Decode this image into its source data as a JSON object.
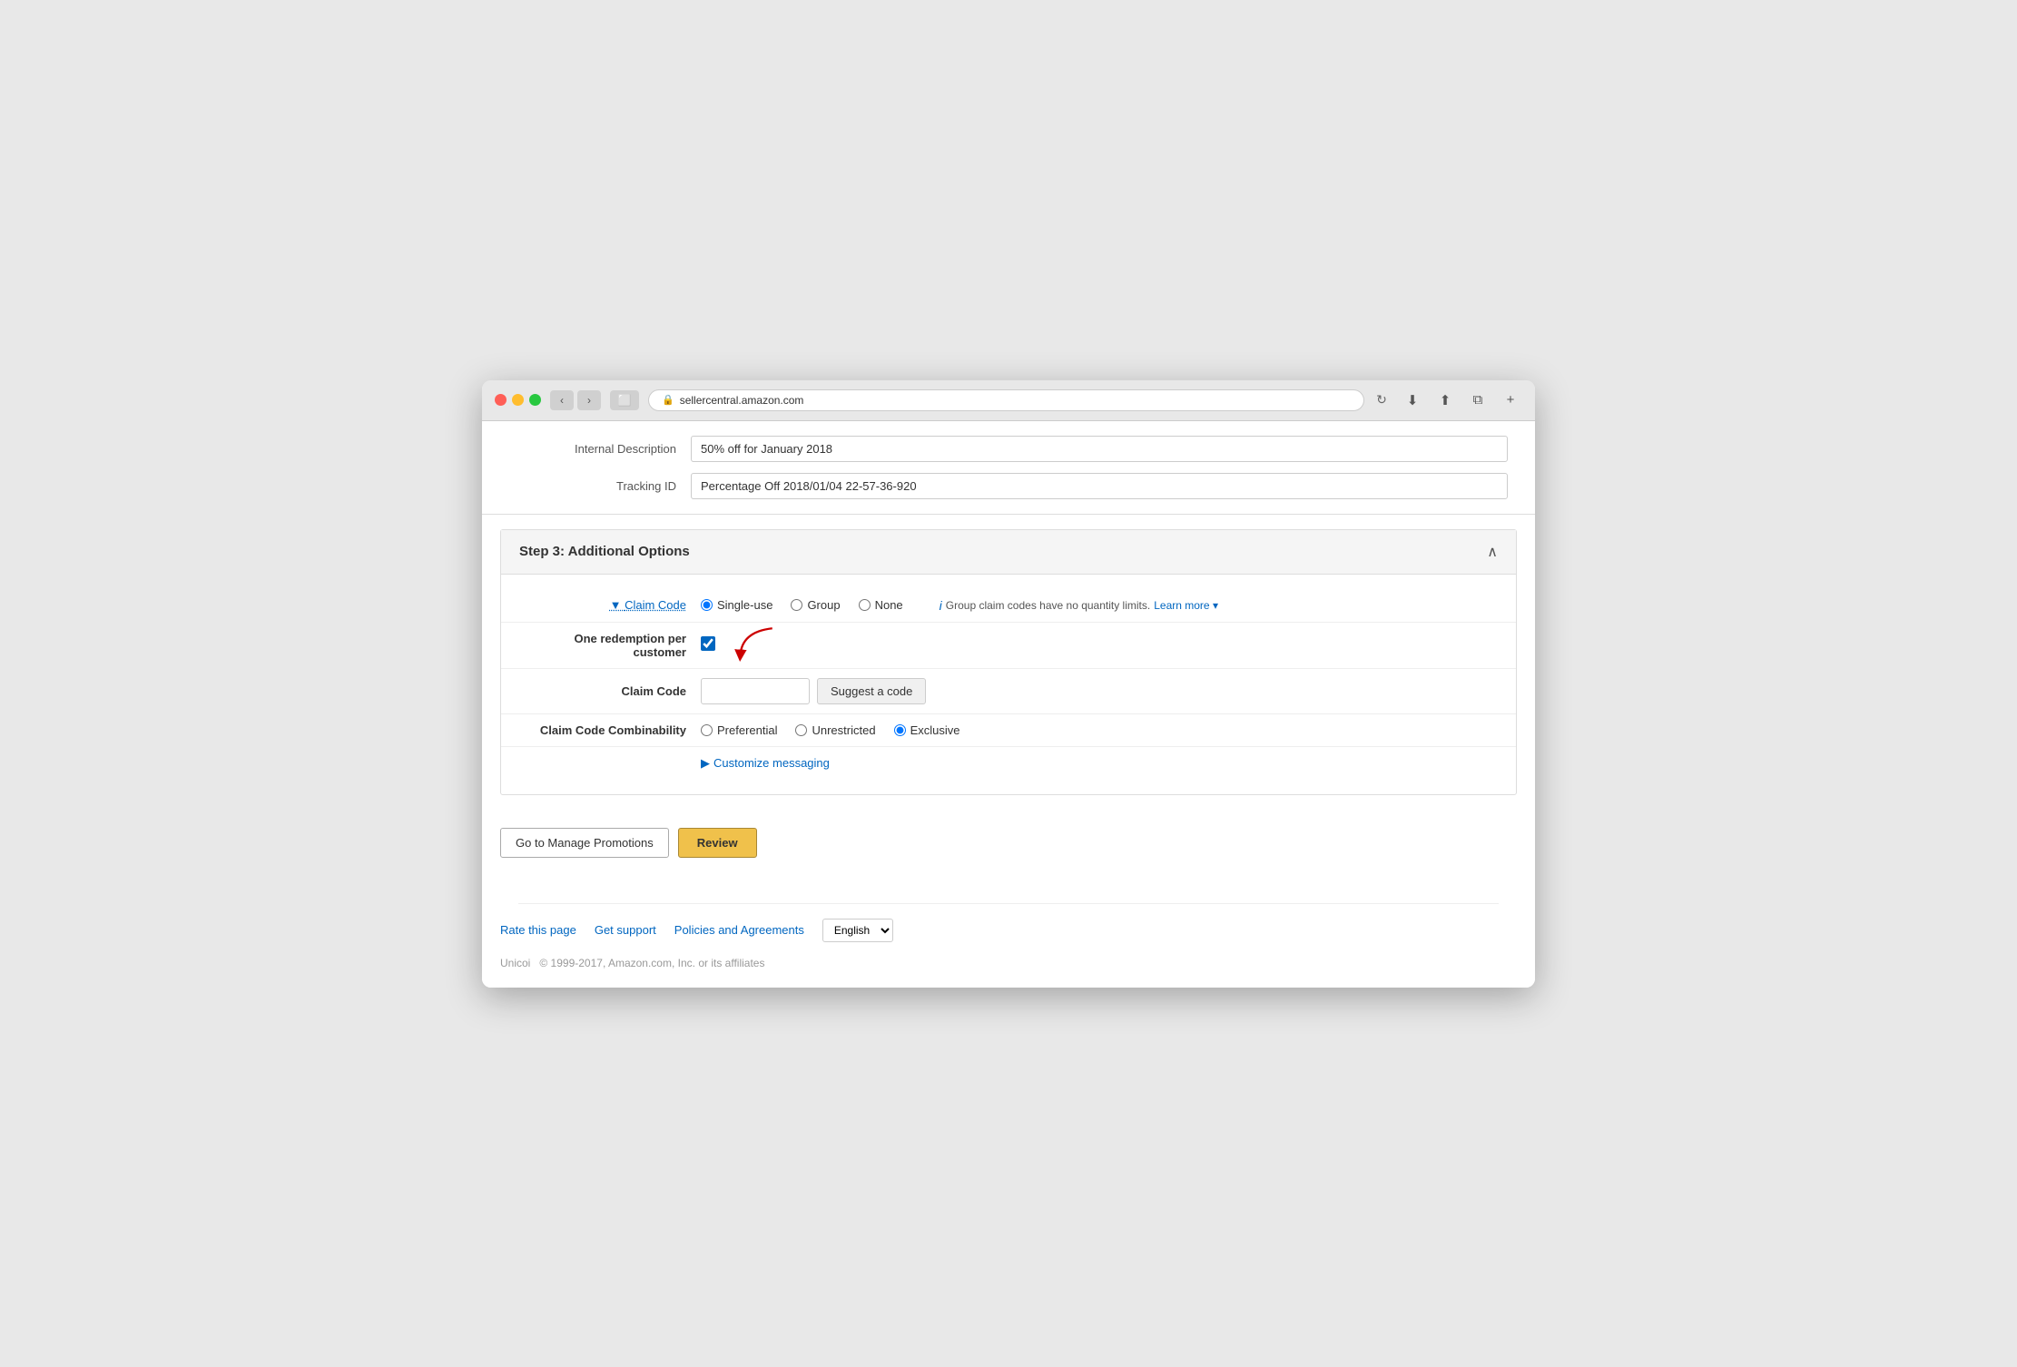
{
  "browser": {
    "url": "sellercentral.amazon.com",
    "back_label": "‹",
    "forward_label": "›",
    "tab_label": "⬜",
    "reload_label": "↻",
    "download_icon": "⬇",
    "share_icon": "⬆",
    "newwindow_icon": "⧉",
    "add_tab_icon": "+"
  },
  "fields": {
    "internal_description_label": "Internal Description",
    "internal_description_value": "50% off for January 2018",
    "tracking_id_label": "Tracking ID",
    "tracking_id_value": "Percentage Off 2018/01/04 22-57-36-920"
  },
  "step3": {
    "title": "Step 3: Additional Options",
    "claim_code_label": "Claim Code",
    "claim_code_options": [
      {
        "id": "single-use",
        "label": "Single-use",
        "checked": true
      },
      {
        "id": "group",
        "label": "Group",
        "checked": false
      },
      {
        "id": "none",
        "label": "None",
        "checked": false
      }
    ],
    "group_info_text": "Group claim codes have no quantity limits.",
    "learn_more_text": "Learn more",
    "one_redemption_label": "One redemption per customer",
    "claim_code_input_label": "Claim Code",
    "suggest_code_label": "Suggest a code",
    "combinability_label": "Claim Code Combinability",
    "combinability_options": [
      {
        "id": "preferential",
        "label": "Preferential",
        "checked": false
      },
      {
        "id": "unrestricted",
        "label": "Unrestricted",
        "checked": false
      },
      {
        "id": "exclusive",
        "label": "Exclusive",
        "checked": true
      }
    ],
    "customize_label": "Customize messaging"
  },
  "actions": {
    "manage_promotions_label": "Go to Manage Promotions",
    "review_label": "Review"
  },
  "footer": {
    "rate_page_label": "Rate this page",
    "get_support_label": "Get support",
    "policies_label": "Policies and Agreements",
    "language_label": "English",
    "copyright": "© 1999-2017, Amazon.com, Inc. or its affiliates",
    "brand": "Unicoi"
  }
}
